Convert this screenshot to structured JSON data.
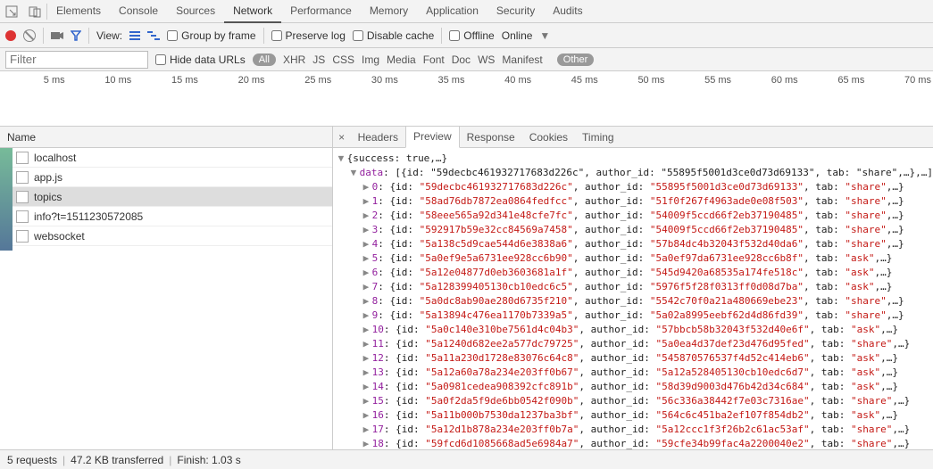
{
  "tabs": [
    "Elements",
    "Console",
    "Sources",
    "Network",
    "Performance",
    "Memory",
    "Application",
    "Security",
    "Audits"
  ],
  "activeTab": "Network",
  "subbar": {
    "view": "View:",
    "groupByFrame": "Group by frame",
    "preserveLog": "Preserve log",
    "disableCache": "Disable cache",
    "offline": "Offline",
    "connection": "Online"
  },
  "filterbar": {
    "placeholder": "Filter",
    "hideDataUrls": "Hide data URLs",
    "all": "All",
    "types": [
      "XHR",
      "JS",
      "CSS",
      "Img",
      "Media",
      "Font",
      "Doc",
      "WS",
      "Manifest"
    ],
    "other": "Other"
  },
  "timeline_ticks": [
    "5 ms",
    "10 ms",
    "15 ms",
    "20 ms",
    "25 ms",
    "30 ms",
    "35 ms",
    "40 ms",
    "45 ms",
    "50 ms",
    "55 ms",
    "60 ms",
    "65 ms",
    "70 ms"
  ],
  "requests_header": "Name",
  "requests": [
    {
      "name": "localhost",
      "selected": false
    },
    {
      "name": "app.js",
      "selected": false
    },
    {
      "name": "topics",
      "selected": true
    },
    {
      "name": "info?t=1511230572085",
      "selected": false
    },
    {
      "name": "websocket",
      "selected": false
    }
  ],
  "preview_tabs": [
    "Headers",
    "Preview",
    "Response",
    "Cookies",
    "Timing"
  ],
  "preview_active": "Preview",
  "preview_root": "{success: true,…}",
  "preview_data_label": "data",
  "preview_data_summary": "[{id: \"59decbc461932717683d226c\", author_id: \"55895f5001d3ce0d73d69133\", tab: \"share\",…},…]",
  "preview_items": [
    {
      "idx": "0",
      "id": "59decbc461932717683d226c",
      "author_id": "55895f5001d3ce0d73d69133",
      "tab": "share"
    },
    {
      "idx": "1",
      "id": "58ad76db7872ea0864fedfcc",
      "author_id": "51f0f267f4963ade0e08f503",
      "tab": "share"
    },
    {
      "idx": "2",
      "id": "58eee565a92d341e48cfe7fc",
      "author_id": "54009f5ccd66f2eb37190485",
      "tab": "share"
    },
    {
      "idx": "3",
      "id": "592917b59e32cc84569a7458",
      "author_id": "54009f5ccd66f2eb37190485",
      "tab": "share"
    },
    {
      "idx": "4",
      "id": "5a138c5d9cae544d6e3838a6",
      "author_id": "57b84dc4b32043f532d40da6",
      "tab": "share"
    },
    {
      "idx": "5",
      "id": "5a0ef9e5a6731ee928cc6b90",
      "author_id": "5a0ef97da6731ee928cc6b8f",
      "tab": "ask"
    },
    {
      "idx": "6",
      "id": "5a12e04877d0eb3603681a1f",
      "author_id": "545d9420a68535a174fe518c",
      "tab": "ask"
    },
    {
      "idx": "7",
      "id": "5a128399405130cb10edc6c5",
      "author_id": "5976f5f28f0313ff0d08d7ba",
      "tab": "ask"
    },
    {
      "idx": "8",
      "id": "5a0dc8ab90ae280d6735f210",
      "author_id": "5542c70f0a21a480669ebe23",
      "tab": "share"
    },
    {
      "idx": "9",
      "id": "5a13894c476ea1170b7339a5",
      "author_id": "5a02a8995eebf62d4d86fd39",
      "tab": "share"
    },
    {
      "idx": "10",
      "id": "5a0c140e310be7561d4c04b3",
      "author_id": "57bbcb58b32043f532d40e6f",
      "tab": "ask"
    },
    {
      "idx": "11",
      "id": "5a1240d682ee2a577dc79725",
      "author_id": "5a0ea4d37def23d476d95fed",
      "tab": "share"
    },
    {
      "idx": "12",
      "id": "5a11a230d1728e83076c64c8",
      "author_id": "545870576537f4d52c414eb6",
      "tab": "ask"
    },
    {
      "idx": "13",
      "id": "5a12a60a78a234e203ff0b67",
      "author_id": "5a12a528405130cb10edc6d7",
      "tab": "ask"
    },
    {
      "idx": "14",
      "id": "5a0981cedea908392cfc891b",
      "author_id": "58d39d9003d476b42d34c684",
      "tab": "ask"
    },
    {
      "idx": "15",
      "id": "5a0f2da5f9de6bb0542f090b",
      "author_id": "56c336a38442f7e03c7316ae",
      "tab": "share"
    },
    {
      "idx": "16",
      "id": "5a11b000b7530da1237ba3bf",
      "author_id": "564c6c451ba2ef107f854db2",
      "tab": "ask"
    },
    {
      "idx": "17",
      "id": "5a12d1b878a234e203ff0b7a",
      "author_id": "5a12ccc1f3f26b2c61ac53af",
      "tab": "share"
    },
    {
      "idx": "18",
      "id": "59fcd6d1085668ad5e6984a7",
      "author_id": "59cfe34b99fac4a2200040e2",
      "tab": "share"
    }
  ],
  "status": {
    "requests": "5 requests",
    "transferred": "47.2 KB transferred",
    "finish": "Finish: 1.03 s"
  }
}
